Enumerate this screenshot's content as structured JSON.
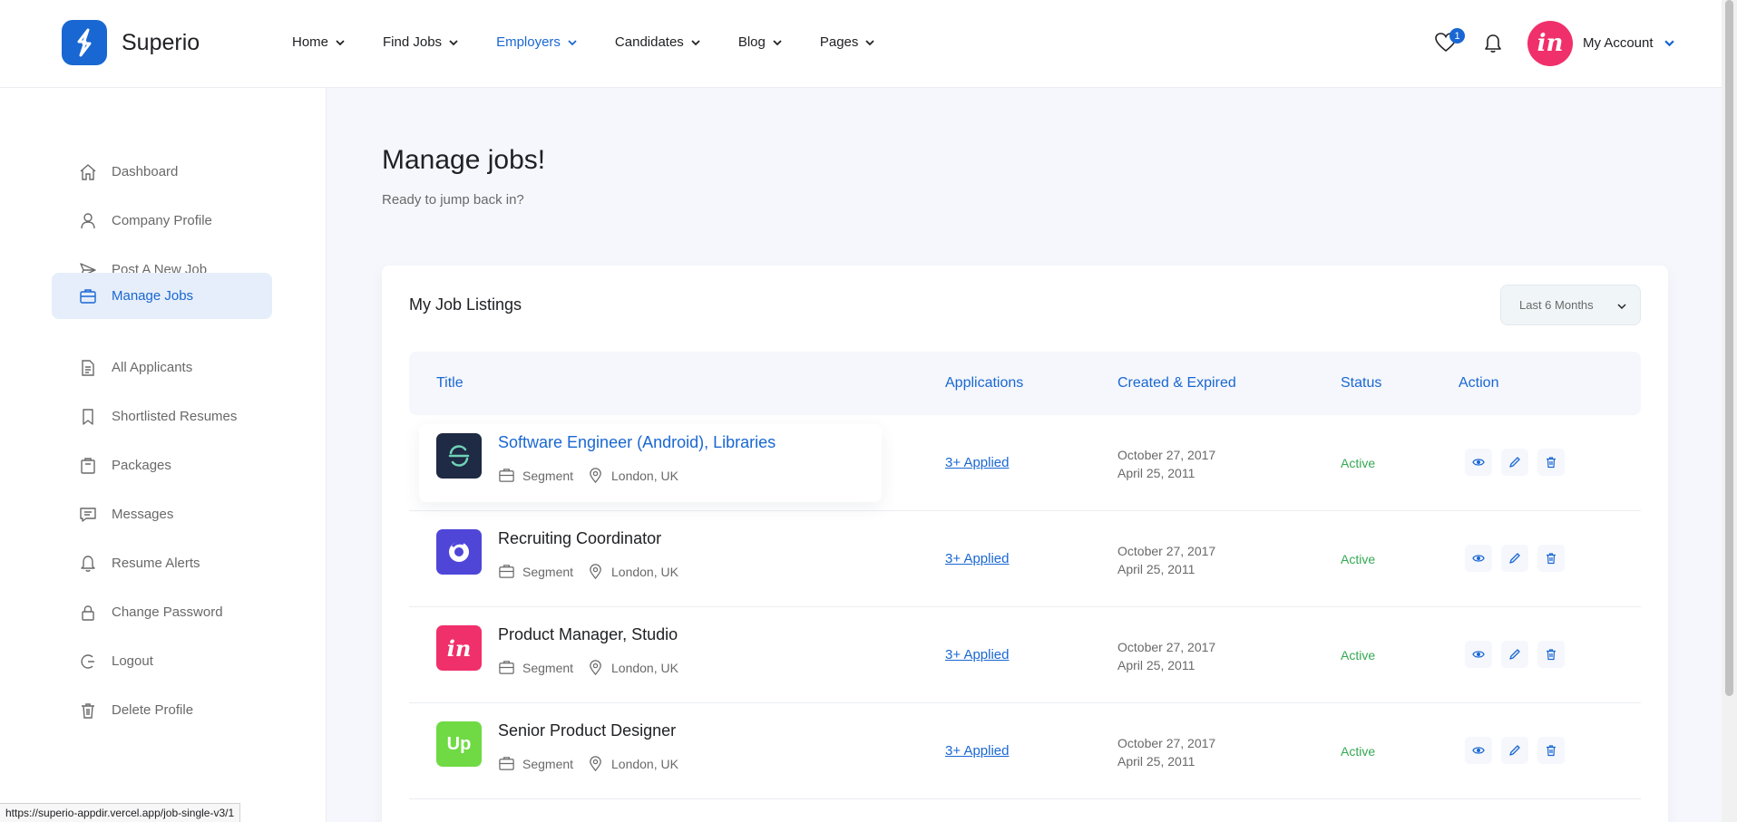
{
  "brand": {
    "name": "Superio",
    "primary_color": "#1967d2",
    "accent_color": "#f0306b"
  },
  "nav": [
    {
      "label": "Home",
      "active": false
    },
    {
      "label": "Find Jobs",
      "active": false
    },
    {
      "label": "Employers",
      "active": true
    },
    {
      "label": "Candidates",
      "active": false
    },
    {
      "label": "Blog",
      "active": false
    },
    {
      "label": "Pages",
      "active": false
    }
  ],
  "header": {
    "wishlist_count": "1",
    "account_label": "My Account",
    "avatar_text": "in"
  },
  "sidebar": {
    "items": [
      {
        "label": "Dashboard",
        "icon": "home-icon"
      },
      {
        "label": "Company Profile",
        "icon": "user-icon"
      },
      {
        "label": "Post A New Job",
        "icon": "paper-plane-icon"
      },
      {
        "label": "Manage Jobs",
        "icon": "briefcase-icon",
        "active": true
      },
      {
        "label": "All Applicants",
        "icon": "file-icon"
      },
      {
        "label": "Shortlisted Resumes",
        "icon": "bookmark-icon"
      },
      {
        "label": "Packages",
        "icon": "package-icon"
      },
      {
        "label": "Messages",
        "icon": "message-icon"
      },
      {
        "label": "Resume Alerts",
        "icon": "bell-icon"
      },
      {
        "label": "Change Password",
        "icon": "lock-icon"
      },
      {
        "label": "Logout",
        "icon": "logout-icon"
      },
      {
        "label": "Delete Profile",
        "icon": "trash-icon"
      }
    ]
  },
  "page": {
    "title": "Manage jobs!",
    "subtitle": "Ready to jump back in?"
  },
  "listings": {
    "title": "My Job Listings",
    "filter_value": "Last 6 Months",
    "columns": [
      "Title",
      "Applications",
      "Created & Expired",
      "Status",
      "Action"
    ],
    "rows": [
      {
        "title": "Software Engineer (Android), Libraries",
        "company": "Segment",
        "location": "London, UK",
        "applications": "3+ Applied",
        "created": "October 27, 2017",
        "expired": "April 25, 2011",
        "status": "Active",
        "logo": "segment-logo",
        "logo_color": "#1f2a44"
      },
      {
        "title": "Recruiting Coordinator",
        "company": "Segment",
        "location": "London, UK",
        "applications": "3+ Applied",
        "created": "October 27, 2017",
        "expired": "April 25, 2011",
        "status": "Active",
        "logo": "circle-logo",
        "logo_color": "#4f46d8"
      },
      {
        "title": "Product Manager, Studio",
        "company": "Segment",
        "location": "London, UK",
        "applications": "3+ Applied",
        "created": "October 27, 2017",
        "expired": "April 25, 2011",
        "status": "Active",
        "logo": "invision-logo",
        "logo_color": "#f0306b",
        "logo_text": "in"
      },
      {
        "title": "Senior Product Designer",
        "company": "Segment",
        "location": "London, UK",
        "applications": "3+ Applied",
        "created": "October 27, 2017",
        "expired": "April 25, 2011",
        "status": "Active",
        "logo": "upwork-logo",
        "logo_color": "#6fda44",
        "logo_text": "Up"
      }
    ]
  },
  "status_url": "https://superio-appdir.vercel.app/job-single-v3/1"
}
